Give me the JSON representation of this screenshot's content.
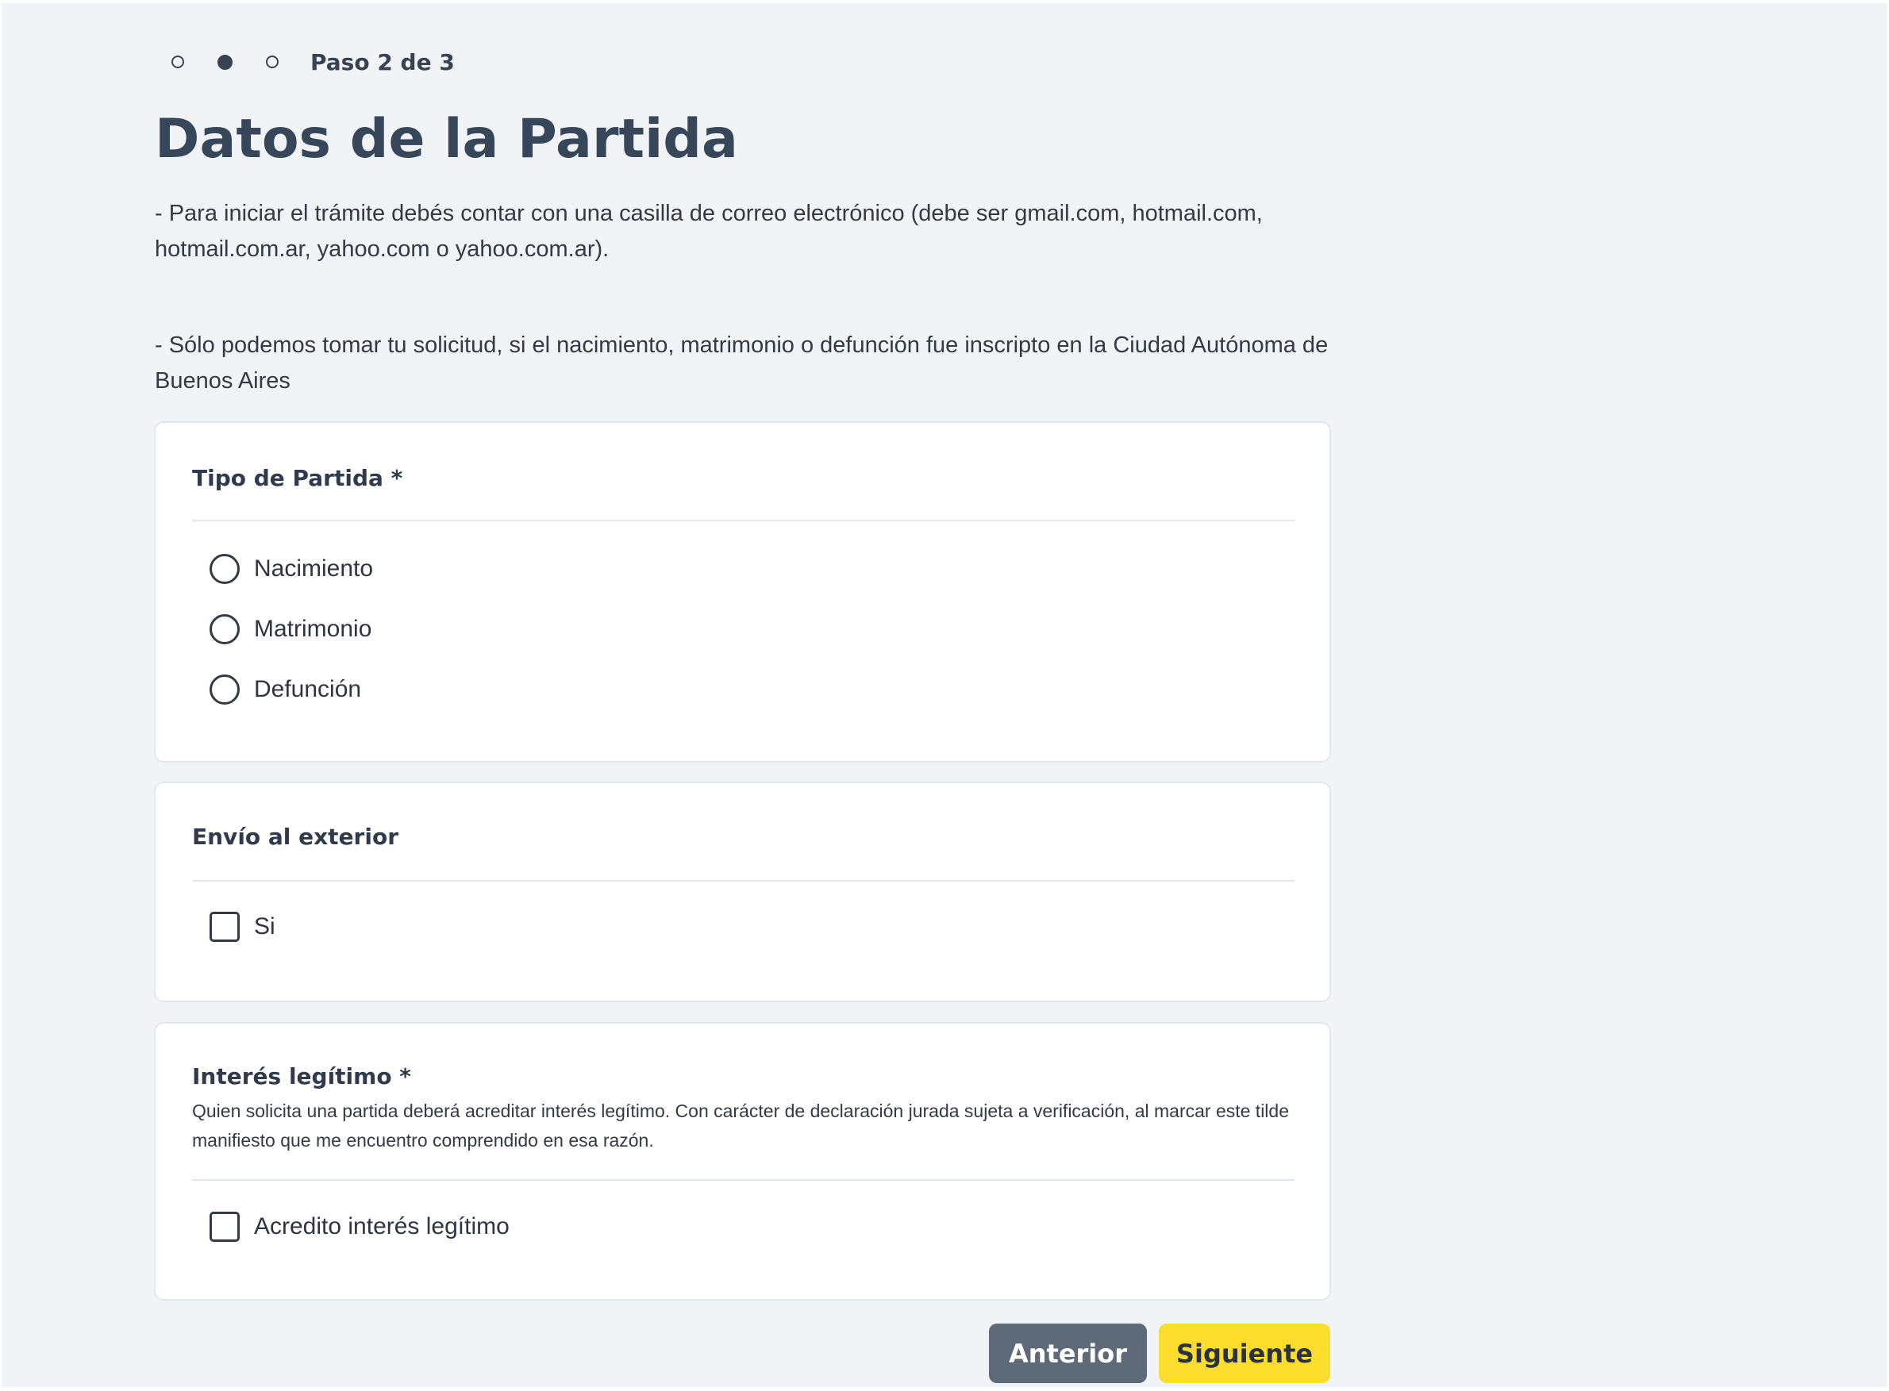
{
  "stepper": {
    "steps": [
      {
        "state": "inactive"
      },
      {
        "state": "active"
      },
      {
        "state": "inactive"
      }
    ],
    "label": "Paso 2 de 3"
  },
  "page": {
    "title": "Datos de la Partida",
    "intro": [
      "- Para iniciar el trámite debés contar con una casilla de correo electrónico (debe ser gmail.com, hotmail.com, hotmail.com.ar, yahoo.com o yahoo.com.ar).",
      "- Sólo podemos tomar tu solicitud, si el nacimiento, matrimonio o defunción fue inscripto en la Ciudad Autónoma de Buenos Aires"
    ]
  },
  "tipo_partida": {
    "title": "Tipo de Partida *",
    "options": [
      {
        "label": "Nacimiento",
        "checked": false
      },
      {
        "label": "Matrimonio",
        "checked": false
      },
      {
        "label": "Defunción",
        "checked": false
      }
    ]
  },
  "envio_exterior": {
    "title": "Envío al exterior",
    "option": {
      "label": "Si",
      "checked": false
    }
  },
  "interes_legitimo": {
    "title": "Interés legítimo *",
    "description": "Quien solicita una partida deberá acreditar interés legítimo. Con carácter de declaración jurada sujeta a verificación, al marcar este tilde manifiesto que me encuentro comprendido en esa razón.",
    "option": {
      "label": "Acredito interés legítimo",
      "checked": false
    }
  },
  "actions": {
    "previous": "Anterior",
    "next": "Siguiente"
  },
  "colors": {
    "background": "#f1f4f7",
    "text": "#2d3a4b",
    "previous_button": "#5e6a78",
    "next_button": "#fcdc2c"
  }
}
